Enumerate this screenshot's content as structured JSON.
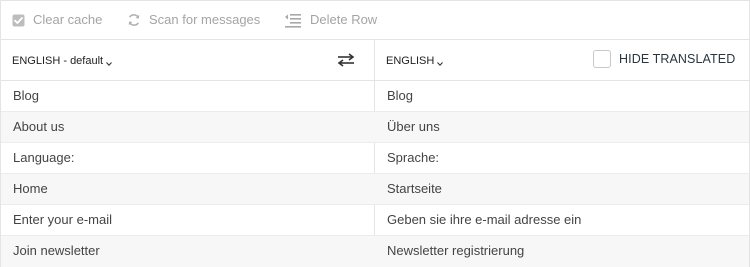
{
  "toolbar": {
    "clear_cache": "Clear cache",
    "scan_messages": "Scan for messages",
    "delete_row": "Delete Row"
  },
  "header": {
    "source_language": "ENGLISH - default",
    "target_language": "ENGLISH",
    "hide_translated": "HIDE TRANSLATED",
    "hide_translated_checked": false
  },
  "rows": [
    {
      "source": "Blog",
      "translation": "Blog"
    },
    {
      "source": "About us",
      "translation": "Über uns"
    },
    {
      "source": "Language:",
      "translation": "Sprache:"
    },
    {
      "source": "Home",
      "translation": "Startseite"
    },
    {
      "source": "Enter your e-mail",
      "translation": "Geben sie ihre e-mail adresse ein"
    },
    {
      "source": "Join newsletter",
      "translation": "Newsletter registrierung"
    }
  ],
  "icons": {
    "clear_cache": "checkbox-checked-icon",
    "scan_messages": "refresh-icon",
    "delete_row": "outdent-list-icon",
    "swap": "swap-arrows-icon",
    "caret": "chevron-down-icon"
  },
  "colors": {
    "toolbar_text": "#a4a4a4",
    "border": "#e4e4e4",
    "alt_row": "#f7f7f7",
    "text": "#444444"
  }
}
